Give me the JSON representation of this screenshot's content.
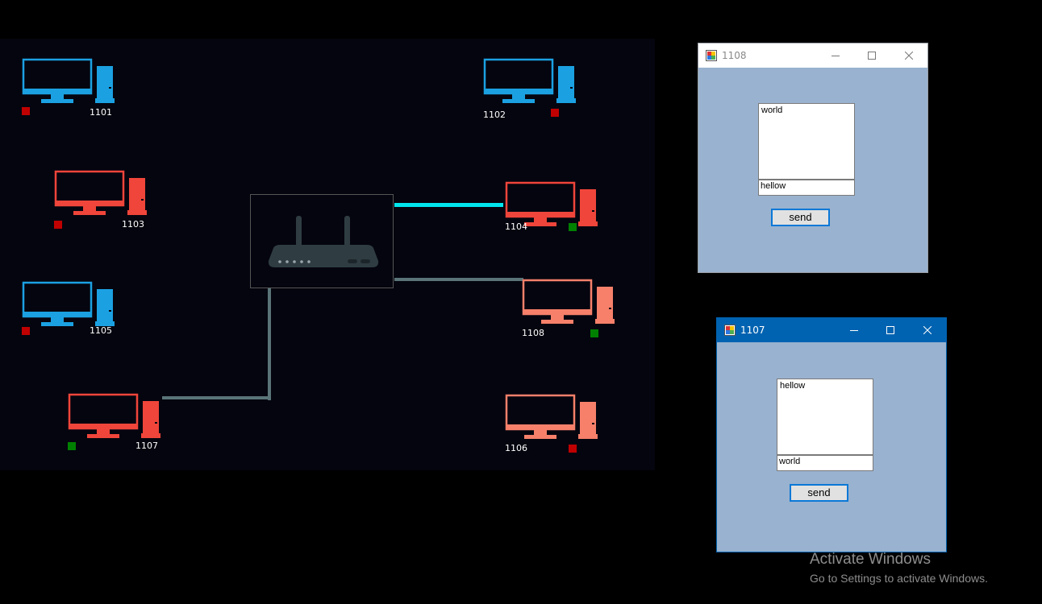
{
  "computers": [
    {
      "id": "pc-1101",
      "label": "1101",
      "color": "#1ba1e2",
      "status": "#c00000"
    },
    {
      "id": "pc-1102",
      "label": "1102",
      "color": "#1ba1e2",
      "status": "#c00000"
    },
    {
      "id": "pc-1103",
      "label": "1103",
      "color": "#f0453a",
      "status": "#c00000"
    },
    {
      "id": "pc-1104",
      "label": "1104",
      "color": "#f0453a",
      "status": "#008000"
    },
    {
      "id": "pc-1105",
      "label": "1105",
      "color": "#1ba1e2",
      "status": "#c00000"
    },
    {
      "id": "pc-1108",
      "label": "1108",
      "color": "#f6806a",
      "status": "#008000"
    },
    {
      "id": "pc-1107",
      "label": "1107",
      "color": "#f0453a",
      "status": "#008000"
    },
    {
      "id": "pc-1106",
      "label": "1106",
      "color": "#f6806a",
      "status": "#c00000"
    }
  ],
  "links": {
    "active_color": "#00e5ee",
    "idle_color": "#5a7478"
  },
  "router": {
    "icon": "wifi-router-icon"
  },
  "window_1108": {
    "title": "1108",
    "received": "world",
    "input": "hellow",
    "send_label": "send",
    "active": false
  },
  "window_1107": {
    "title": "1107",
    "received": "hellow",
    "input": "world",
    "send_label": "send",
    "active": true,
    "titlebar_color": "#0063b1"
  },
  "watermark": {
    "line1": "Activate Windows",
    "line2": "Go to Settings to activate Windows."
  }
}
